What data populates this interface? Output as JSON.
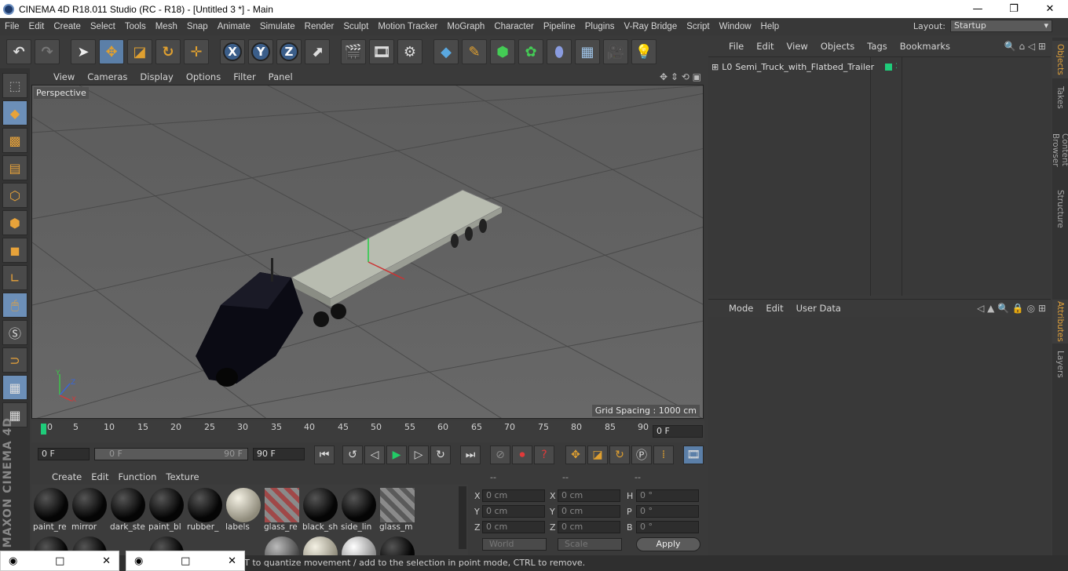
{
  "window": {
    "title": "CINEMA 4D R18.011 Studio (RC - R18) - [Untitled 3 *] - Main",
    "minimize": "—",
    "maximize": "❐",
    "close": "✕"
  },
  "menu": {
    "items": [
      "File",
      "Edit",
      "Create",
      "Select",
      "Tools",
      "Mesh",
      "Snap",
      "Animate",
      "Simulate",
      "Render",
      "Sculpt",
      "Motion Tracker",
      "MoGraph",
      "Character",
      "Pipeline",
      "Plugins",
      "V-Ray Bridge",
      "Script",
      "Window",
      "Help"
    ],
    "layout_label": "Layout:",
    "layout_value": "Startup"
  },
  "toolbar": {
    "x_label": "X",
    "y_label": "Y",
    "z_label": "Z"
  },
  "viewport": {
    "menu": [
      "View",
      "Cameras",
      "Display",
      "Options",
      "Filter",
      "Panel"
    ],
    "camera_label": "Perspective",
    "grid_spacing": "Grid Spacing : 1000 cm",
    "axis_x": "X",
    "axis_y": "Y",
    "axis_z": "Z"
  },
  "timeline": {
    "ticks": [
      "0",
      "5",
      "10",
      "15",
      "20",
      "25",
      "30",
      "35",
      "40",
      "45",
      "50",
      "55",
      "60",
      "65",
      "70",
      "75",
      "80",
      "85",
      "90"
    ],
    "current_frame": "0 F",
    "start_field": "0 F",
    "range_start": "0 F",
    "range_end": "90 F",
    "end_field": "90 F"
  },
  "materials": {
    "menu": [
      "Create",
      "Edit",
      "Function",
      "Texture"
    ],
    "items": [
      {
        "label": "paint_re",
        "color": "#0a0a0a"
      },
      {
        "label": "mirror",
        "color": "#0a0a0a"
      },
      {
        "label": "dark_ste",
        "color": "#0a0a0a"
      },
      {
        "label": "paint_bl",
        "color": "#0a0a0a"
      },
      {
        "label": "rubber_",
        "color": "#0a0a0a"
      },
      {
        "label": "labels",
        "color": "#d8d4c4"
      },
      {
        "label": "glass_re",
        "color": "#b05050"
      },
      {
        "label": "black_sh",
        "color": "#0a0a0a"
      },
      {
        "label": "side_lin",
        "color": "#0a0a0a"
      },
      {
        "label": "glass_m",
        "color": "#6a6a6a"
      }
    ]
  },
  "coords": {
    "headers": [
      "--",
      "--",
      "--"
    ],
    "rows": [
      {
        "a": "X",
        "av": "0 cm",
        "b": "X",
        "bv": "0 cm",
        "c": "H",
        "cv": "0 °"
      },
      {
        "a": "Y",
        "av": "0 cm",
        "b": "Y",
        "bv": "0 cm",
        "c": "P",
        "cv": "0 °"
      },
      {
        "a": "Z",
        "av": "0 cm",
        "b": "Z",
        "bv": "0 cm",
        "c": "B",
        "cv": "0 °"
      }
    ],
    "world": "World",
    "scale": "Scale",
    "apply": "Apply"
  },
  "objects": {
    "menu": [
      "File",
      "Edit",
      "View",
      "Objects",
      "Tags",
      "Bookmarks"
    ],
    "items": [
      {
        "name": "Semi_Truck_with_Flatbed_Trailer"
      }
    ]
  },
  "attributes": {
    "menu": [
      "Mode",
      "Edit",
      "User Data"
    ]
  },
  "right_tabs": [
    "Objects",
    "Takes",
    "Content Browser",
    "Structure",
    "Attributes",
    "Layers"
  ],
  "status": {
    "text": "FT to quantize movement / add to the selection in point mode, CTRL to remove."
  },
  "taskbar": {
    "item1_min": "□",
    "item1_close": "✕"
  }
}
